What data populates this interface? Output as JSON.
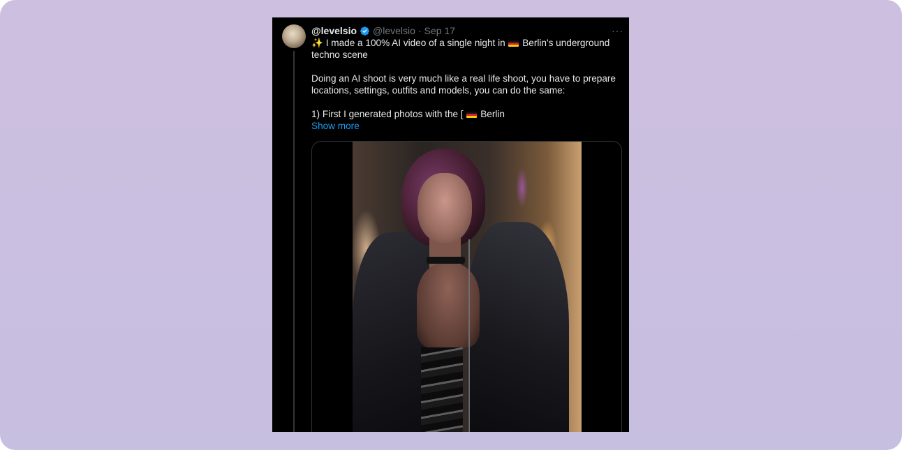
{
  "tweet": {
    "display_name": "@levelsio",
    "handle": "@levelsio",
    "separator": "·",
    "date": "Sep 17",
    "more_label": "···",
    "line1_text_a": "I made a 100% AI video of a single night in",
    "line1_text_b": "Berlin's underground techno scene",
    "paragraph2": "Doing an AI shoot is very much like a real life shoot, you have to prepare locations, settings, outfits and models, you can do the same:",
    "paragraph3_a": "1) First I generated photos with the [",
    "paragraph3_b": "Berlin",
    "show_more": "Show more",
    "sparkle_emoji": "✨"
  },
  "colors": {
    "background": "#c8bfe0",
    "card": "#000000",
    "link": "#1d9bf0",
    "verified": "#1d9bf0"
  },
  "icons": {
    "verified": "verified-badge-icon",
    "flag": "german-flag-icon",
    "more": "more-icon"
  }
}
